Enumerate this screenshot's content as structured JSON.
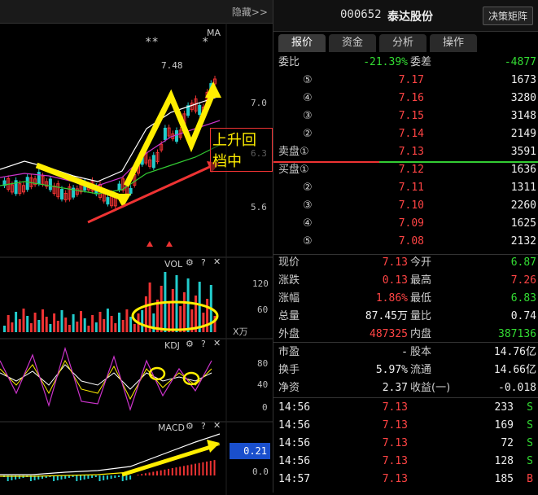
{
  "left": {
    "hide_label": "隐藏>>",
    "price_axis": [
      "7.0",
      "6.3",
      "5.6"
    ],
    "ma_label": "MA",
    "peak_label": "7.48",
    "stars": [
      "**",
      "*"
    ],
    "annotation": "上升回档中",
    "vol": {
      "title": "VOL",
      "axis": [
        "120",
        "60"
      ],
      "unit": "X万"
    },
    "kdj": {
      "title": "KDJ",
      "axis": [
        "80",
        "40",
        "0"
      ]
    },
    "macd": {
      "title": "MACD",
      "axis": [
        "0.21",
        "0.0"
      ]
    }
  },
  "right": {
    "code": "000652",
    "name": "泰达股份",
    "matrix_button": "决策矩阵",
    "tabs": [
      "报价",
      "资金",
      "分析",
      "操作"
    ],
    "weibi": {
      "label1": "委比",
      "value1": "-21.39%",
      "label2": "委差",
      "value2": "-4877"
    },
    "sell": [
      {
        "lvl": "⑤",
        "price": "7.17",
        "vol": "1673"
      },
      {
        "lvl": "④",
        "price": "7.16",
        "vol": "3280"
      },
      {
        "lvl": "③",
        "price": "7.15",
        "vol": "3148"
      },
      {
        "lvl": "②",
        "price": "7.14",
        "vol": "2149"
      },
      {
        "lvl": "卖盘①",
        "price": "7.13",
        "vol": "3591"
      }
    ],
    "buy": [
      {
        "lvl": "买盘①",
        "price": "7.12",
        "vol": "1636"
      },
      {
        "lvl": "②",
        "price": "7.11",
        "vol": "1311"
      },
      {
        "lvl": "③",
        "price": "7.10",
        "vol": "2260"
      },
      {
        "lvl": "④",
        "price": "7.09",
        "vol": "1625"
      },
      {
        "lvl": "⑤",
        "price": "7.08",
        "vol": "2132"
      }
    ],
    "stats": [
      {
        "l1": "现价",
        "v1": "7.13",
        "c1": "red",
        "l2": "今开",
        "v2": "6.87",
        "c2": "green"
      },
      {
        "l1": "涨跌",
        "v1": "0.13",
        "c1": "red",
        "l2": "最高",
        "v2": "7.26",
        "c2": "red"
      },
      {
        "l1": "涨幅",
        "v1": "1.86%",
        "c1": "red",
        "l2": "最低",
        "v2": "6.83",
        "c2": "green"
      },
      {
        "l1": "总量",
        "v1": "87.45万",
        "c1": "white",
        "l2": "量比",
        "v2": "0.74",
        "c2": "white"
      },
      {
        "l1": "外盘",
        "v1": "487325",
        "c1": "red",
        "l2": "内盘",
        "v2": "387136",
        "c2": "green"
      }
    ],
    "stats2": [
      {
        "l1": "市盈",
        "v1": "-",
        "l2": "股本",
        "v2": "14.76亿"
      },
      {
        "l1": "换手",
        "v1": "5.97%",
        "l2": "流通",
        "v2": "14.66亿"
      },
      {
        "l1": "净资",
        "v1": "2.37",
        "l2": "收益(一)",
        "v2": "-0.018"
      }
    ],
    "trades": [
      {
        "time": "14:56",
        "price": "7.13",
        "vol": "233",
        "side": "S"
      },
      {
        "time": "14:56",
        "price": "7.13",
        "vol": "169",
        "side": "S"
      },
      {
        "time": "14:56",
        "price": "7.13",
        "vol": "72",
        "side": "S"
      },
      {
        "time": "14:56",
        "price": "7.13",
        "vol": "128",
        "side": "S"
      },
      {
        "time": "14:57",
        "price": "7.13",
        "vol": "185",
        "side": "B"
      }
    ]
  }
}
